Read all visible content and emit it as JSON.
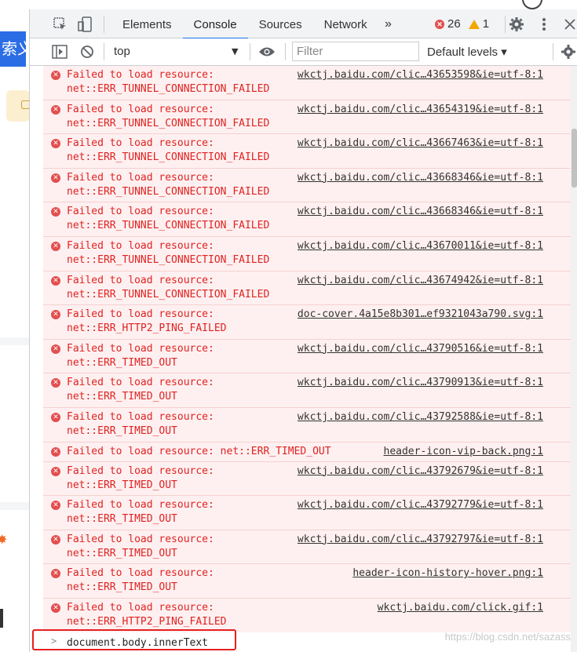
{
  "page": {
    "blue_button_text": "索义",
    "watermark": "https://blog.csdn.net/sazass"
  },
  "devtools": {
    "tabs": [
      {
        "label": "Elements"
      },
      {
        "label": "Console"
      },
      {
        "label": "Sources"
      },
      {
        "label": "Network"
      }
    ],
    "more_tabs": "»",
    "error_count": "26",
    "warning_count": "1",
    "context": "top",
    "filter_placeholder": "Filter",
    "levels": "Default levels ▾"
  },
  "console": {
    "messages": [
      {
        "line1": "Failed to load resource:",
        "line2": "net::ERR_TUNNEL_CONNECTION_FAILED",
        "source": "wkctj.baidu.com/clic…43653598&ie=utf-8:1"
      },
      {
        "line1": "Failed to load resource:",
        "line2": "net::ERR_TUNNEL_CONNECTION_FAILED",
        "source": "wkctj.baidu.com/clic…43654319&ie=utf-8:1"
      },
      {
        "line1": "Failed to load resource:",
        "line2": "net::ERR_TUNNEL_CONNECTION_FAILED",
        "source": "wkctj.baidu.com/clic…43667463&ie=utf-8:1"
      },
      {
        "line1": "Failed to load resource:",
        "line2": "net::ERR_TUNNEL_CONNECTION_FAILED",
        "source": "wkctj.baidu.com/clic…43668346&ie=utf-8:1"
      },
      {
        "line1": "Failed to load resource:",
        "line2": "net::ERR_TUNNEL_CONNECTION_FAILED",
        "source": "wkctj.baidu.com/clic…43668346&ie=utf-8:1"
      },
      {
        "line1": "Failed to load resource:",
        "line2": "net::ERR_TUNNEL_CONNECTION_FAILED",
        "source": "wkctj.baidu.com/clic…43670011&ie=utf-8:1"
      },
      {
        "line1": "Failed to load resource:",
        "line2": "net::ERR_TUNNEL_CONNECTION_FAILED",
        "source": "wkctj.baidu.com/clic…43674942&ie=utf-8:1"
      },
      {
        "line1": "Failed to load resource:",
        "line2": "net::ERR_HTTP2_PING_FAILED",
        "source": "doc-cover.4a15e8b301…ef9321043a790.svg:1"
      },
      {
        "line1": "Failed to load resource:",
        "line2": "net::ERR_TIMED_OUT",
        "source": "wkctj.baidu.com/clic…43790516&ie=utf-8:1"
      },
      {
        "line1": "Failed to load resource:",
        "line2": "net::ERR_TIMED_OUT",
        "source": "wkctj.baidu.com/clic…43790913&ie=utf-8:1"
      },
      {
        "line1": "Failed to load resource:",
        "line2": "net::ERR_TIMED_OUT",
        "source": "wkctj.baidu.com/clic…43792588&ie=utf-8:1"
      },
      {
        "line1": "Failed to load resource: net::ERR_TIMED_OUT",
        "line2": "",
        "source": "header-icon-vip-back.png:1"
      },
      {
        "line1": "Failed to load resource:",
        "line2": "net::ERR_TIMED_OUT",
        "source": "wkctj.baidu.com/clic…43792679&ie=utf-8:1"
      },
      {
        "line1": "Failed to load resource:",
        "line2": "net::ERR_TIMED_OUT",
        "source": "wkctj.baidu.com/clic…43792779&ie=utf-8:1"
      },
      {
        "line1": "Failed to load resource:",
        "line2": "net::ERR_TIMED_OUT",
        "source": "wkctj.baidu.com/clic…43792797&ie=utf-8:1"
      },
      {
        "line1": "Failed to load resource:",
        "line2": "net::ERR_TIMED_OUT",
        "source": "header-icon-history-hover.png:1"
      },
      {
        "line1": "Failed to load resource:",
        "line2": "net::ERR_HTTP2_PING_FAILED",
        "source": "wkctj.baidu.com/click.gif:1"
      }
    ],
    "prompt_text": "document.body.innerText"
  },
  "colors": {
    "error": "#e02222",
    "error_bg": "#fef0f0",
    "accent": "#1a73e8",
    "highlight": "#e52020"
  }
}
